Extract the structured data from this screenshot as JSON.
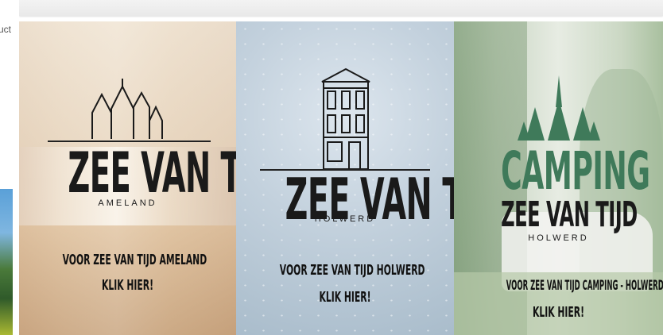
{
  "left_panel": {
    "partial_text": "uct"
  },
  "cards": [
    {
      "brand": "ZEE VAN TIJD",
      "location": "AMELAND",
      "cta_line1": "VOOR ZEE VAN TIJD AMELAND",
      "cta_line2": "KLIK HIER!"
    },
    {
      "brand": "ZEE VAN TIJD",
      "location": "HOLWERD",
      "cta_line1": "VOOR ZEE VAN TIJD HOLWERD",
      "cta_line2": "KLIK HIER!"
    },
    {
      "pre_brand": "CAMPING",
      "brand": "ZEE VAN TIJD",
      "location": "HOLWERD",
      "cta_line1": "VOOR ZEE VAN TIJD CAMPING - HOLWERD",
      "cta_line2": "KLIK HIER!"
    }
  ],
  "colors": {
    "camping_green": "#3f7a5a",
    "logo_black": "#1a1a1a"
  }
}
